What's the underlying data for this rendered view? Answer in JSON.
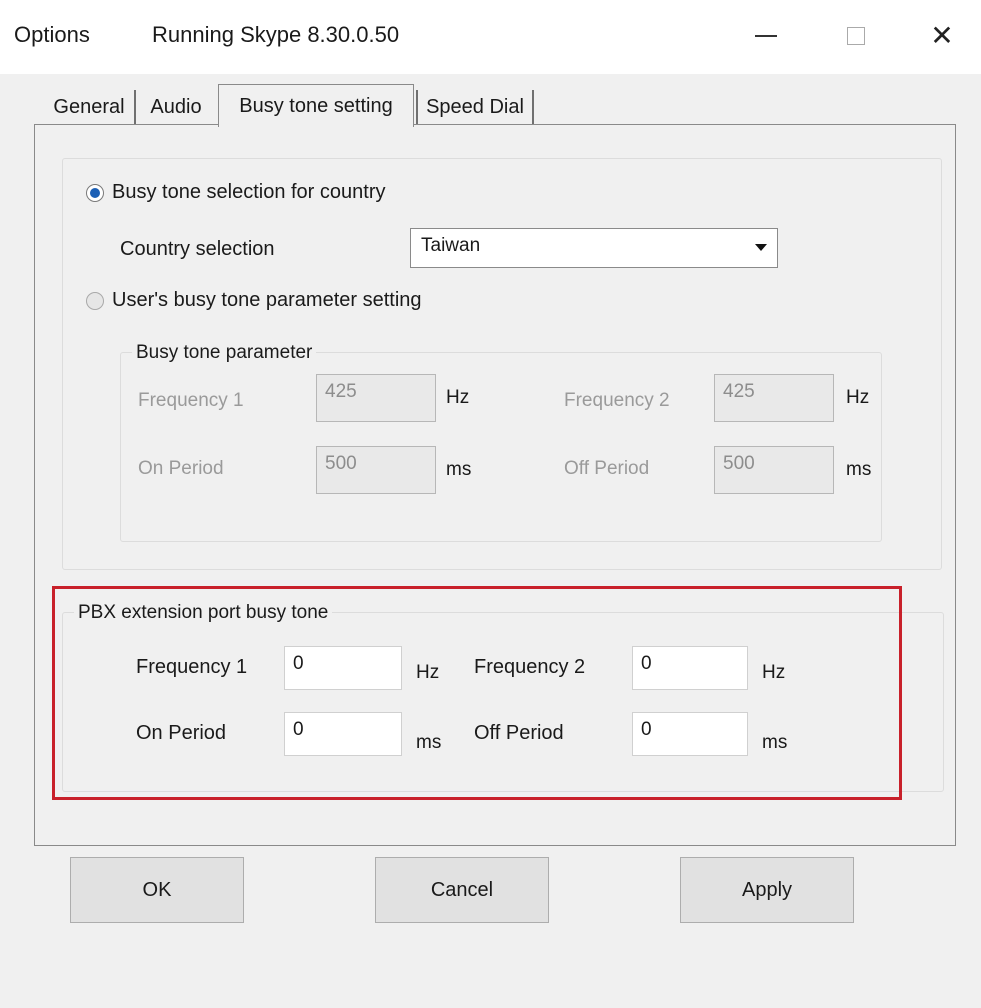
{
  "window": {
    "app_title": "Options",
    "doc_title": "Running Skype 8.30.0.50",
    "minimize_icon": "minimize-icon",
    "maximize_icon": "maximize-icon",
    "close_icon": "close-icon",
    "close_glyph": "✕"
  },
  "tabs": [
    {
      "label": "General",
      "active": false
    },
    {
      "label": "Audio",
      "active": false
    },
    {
      "label": "Busy tone setting",
      "active": true
    },
    {
      "label": "Speed Dial",
      "active": false
    }
  ],
  "busy_tone": {
    "country_radio_label": "Busy tone selection for country",
    "country_radio_selected": true,
    "country_selection_label": "Country selection",
    "country_value": "Taiwan",
    "user_radio_label": "User's busy tone parameter setting",
    "user_radio_selected": false,
    "param_group_title": "Busy tone parameter",
    "freq1_label": "Frequency 1",
    "freq1_value": "425",
    "freq1_unit": "Hz",
    "freq2_label": "Frequency 2",
    "freq2_value": "425",
    "freq2_unit": "Hz",
    "on_label": "On Period",
    "on_value": "500",
    "on_unit": "ms",
    "off_label": "Off Period",
    "off_value": "500",
    "off_unit": "ms"
  },
  "pbx": {
    "group_title": "PBX extension port busy tone",
    "freq1_label": "Frequency 1",
    "freq1_value": "0",
    "freq1_unit": "Hz",
    "freq2_label": "Frequency 2",
    "freq2_value": "0",
    "freq2_unit": "Hz",
    "on_label": "On Period",
    "on_value": "0",
    "on_unit": "ms",
    "off_label": "Off Period",
    "off_value": "0",
    "off_unit": "ms",
    "highlight_color": "#c8202a"
  },
  "buttons": {
    "ok": "OK",
    "cancel": "Cancel",
    "apply": "Apply"
  },
  "colors": {
    "radio_selected": "#1b5fb5",
    "window_bg": "#f0f0f0"
  }
}
